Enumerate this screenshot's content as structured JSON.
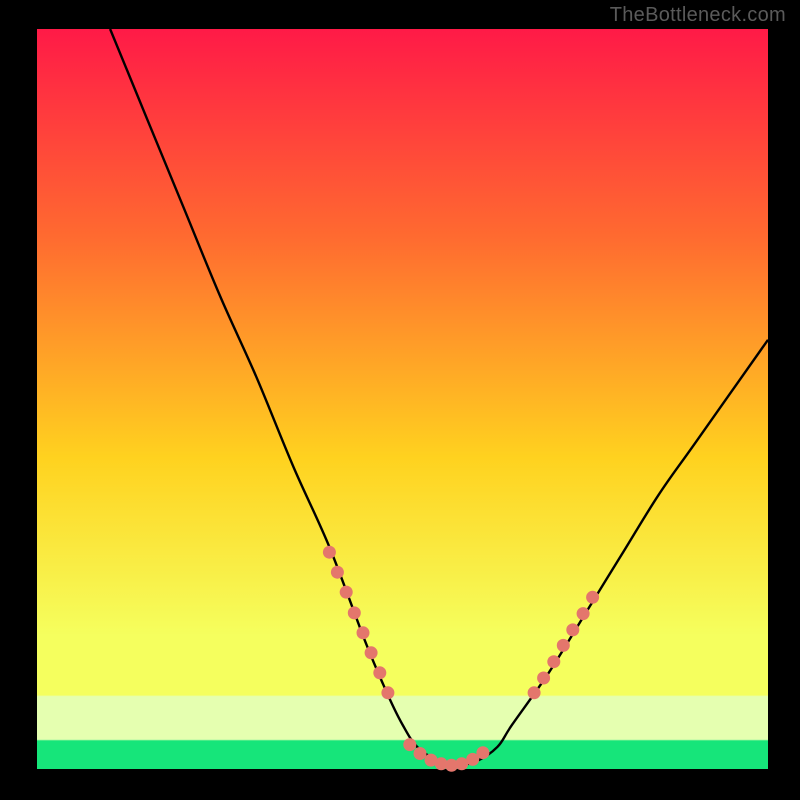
{
  "watermark": "TheBottleneck.com",
  "colors": {
    "background": "#000000",
    "gradient_top": "#ff1a47",
    "gradient_mid1": "#ff6a30",
    "gradient_mid2": "#ffd21f",
    "gradient_low": "#f5ff5e",
    "gradient_pale": "#e5ffb0",
    "gradient_bottom": "#16e57a",
    "curve": "#000000",
    "marker_fill": "#e4766c",
    "marker_stroke": "#d55a52"
  },
  "chart_data": {
    "type": "line",
    "title": "",
    "xlabel": "",
    "ylabel": "",
    "xlim": [
      0,
      100
    ],
    "ylim": [
      0,
      100
    ],
    "series": [
      {
        "name": "bottleneck-curve",
        "x": [
          10,
          15,
          20,
          25,
          30,
          35,
          40,
          45,
          48,
          50,
          52,
          55,
          57,
          60,
          63,
          65,
          70,
          75,
          80,
          85,
          90,
          100
        ],
        "y": [
          100,
          88,
          76,
          64,
          53,
          41,
          30,
          17,
          10,
          6,
          3,
          1,
          0.5,
          1,
          3,
          6,
          13,
          21,
          29,
          37,
          44,
          58
        ]
      }
    ],
    "markers": [
      {
        "name": "left-cluster",
        "x": [
          40.0,
          41.1,
          42.3,
          43.4,
          44.6,
          45.7,
          46.9,
          48.0
        ],
        "y": [
          29.3,
          26.6,
          23.9,
          21.1,
          18.4,
          15.7,
          13.0,
          10.3
        ]
      },
      {
        "name": "bottom-cluster",
        "x": [
          51.0,
          52.4,
          53.9,
          55.3,
          56.7,
          58.1,
          59.6,
          61.0
        ],
        "y": [
          3.3,
          2.1,
          1.2,
          0.7,
          0.5,
          0.7,
          1.3,
          2.2
        ]
      },
      {
        "name": "right-cluster",
        "x": [
          68.0,
          69.3,
          70.7,
          72.0,
          73.3,
          74.7,
          76.0
        ],
        "y": [
          10.3,
          12.3,
          14.5,
          16.7,
          18.8,
          21.0,
          23.2
        ]
      }
    ],
    "gradient_bands": [
      {
        "from": 100,
        "to": 12,
        "desc": "red-orange-yellow smooth gradient"
      },
      {
        "from": 12,
        "to": 5,
        "desc": "pale yellow band"
      },
      {
        "from": 5,
        "to": 0,
        "desc": "green band"
      }
    ]
  }
}
